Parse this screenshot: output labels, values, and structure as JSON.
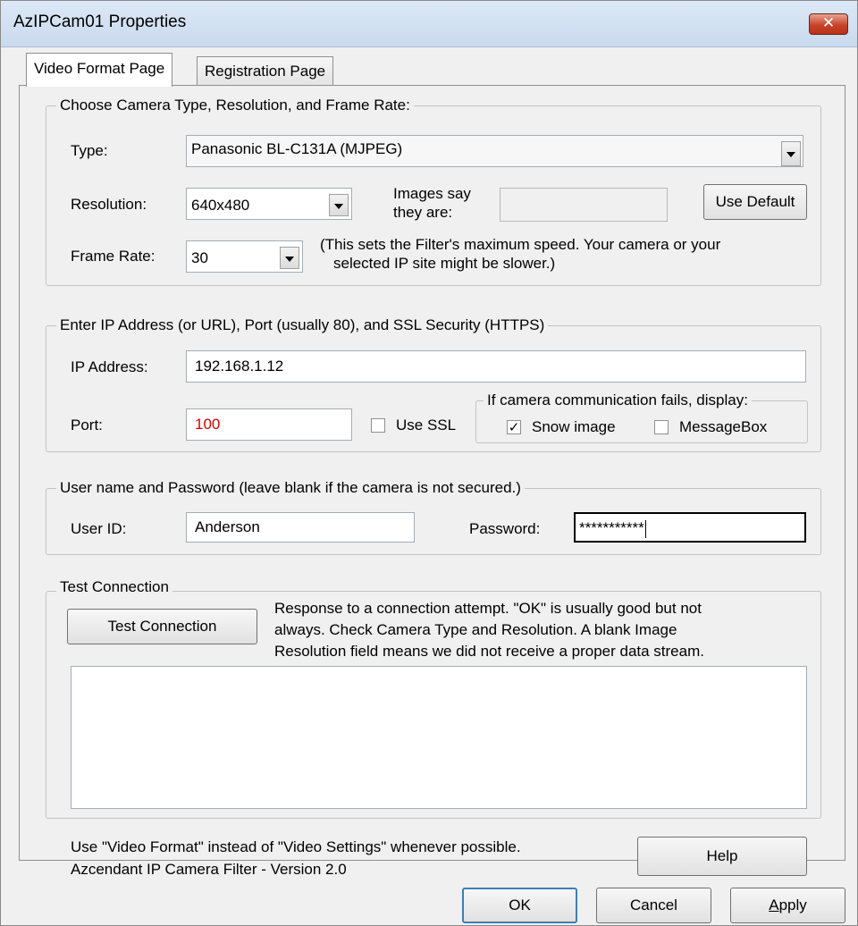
{
  "window": {
    "title": "AzIPCam01 Properties",
    "close_glyph": "✕"
  },
  "tabs": [
    {
      "label": "Video Format Page",
      "active": true
    },
    {
      "label": "Registration Page",
      "active": false
    }
  ],
  "camera_group": {
    "legend": "Choose Camera Type, Resolution, and Frame Rate:",
    "type_label": "Type:",
    "type_value": "Panasonic BL-C131A (MJPEG)",
    "resolution_label": "Resolution:",
    "resolution_value": "640x480",
    "images_say_line1": "Images say",
    "images_say_line2": "they are:",
    "images_say_value": "",
    "use_default_label": "Use Default",
    "frame_rate_label": "Frame Rate:",
    "frame_rate_value": "30",
    "frame_rate_note_line1": "(This sets the Filter's maximum speed.  Your camera or your",
    "frame_rate_note_line2": "selected IP site might be slower.)"
  },
  "ip_group": {
    "legend": "Enter IP Address (or URL), Port (usually 80), and SSL Security (HTTPS)",
    "ip_label": "IP Address:",
    "ip_value": "192.168.1.12",
    "port_label": "Port:",
    "port_value": "100",
    "port_value_color": "#d40000",
    "use_ssl_label": "Use SSL",
    "use_ssl_checked": false,
    "fail_legend": "If camera communication fails, display:",
    "snow_label": "Snow image",
    "snow_checked": true,
    "messagebox_label": "MessageBox",
    "messagebox_checked": false
  },
  "user_group": {
    "legend": "User name and Password (leave blank if the camera is not secured.)",
    "user_label": "User ID:",
    "user_value": "Anderson",
    "password_label": "Password:",
    "password_value": "***********"
  },
  "test_group": {
    "legend": "Test Connection",
    "button_label": "Test Connection",
    "note_line1": "Response to a connection attempt.  \"OK\" is usually good but not",
    "note_line2": "always.  Check Camera Type and Resolution.  A blank Image",
    "note_line3": "Resolution field means we did not receive a proper data stream.",
    "response_text": ""
  },
  "footer": {
    "line1": "Use \"Video Format\" instead of \"Video Settings\" whenever possible.",
    "line2": "Azcendant IP Camera Filter - Version 2.0",
    "help_label": "Help"
  },
  "buttons": {
    "ok": "OK",
    "cancel": "Cancel",
    "apply_prefix": "A",
    "apply_rest": "pply"
  }
}
